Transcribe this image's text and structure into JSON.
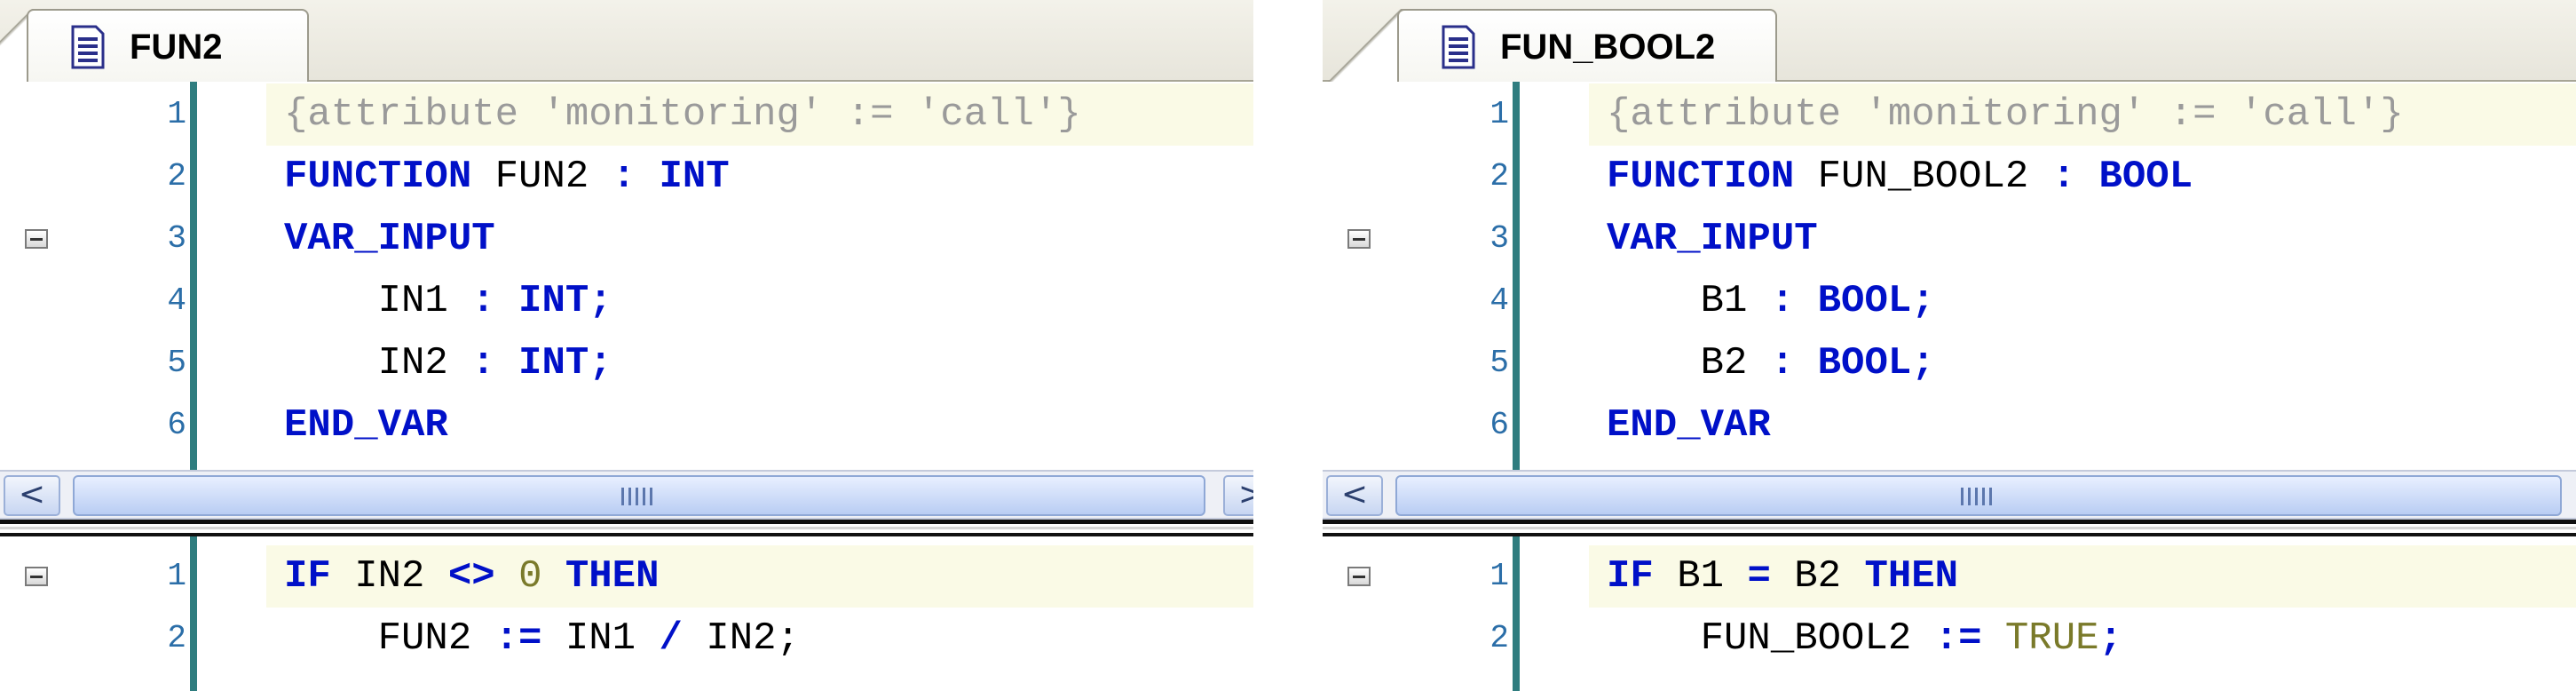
{
  "panels": [
    {
      "tab": {
        "title": "FUN2",
        "icon": "document-icon"
      },
      "declaration": {
        "lines": [
          {
            "n": "1",
            "tokens": [
              {
                "t": "{attribute 'monitoring' := 'call'}",
                "c": "cmt"
              }
            ],
            "highlight": true
          },
          {
            "n": "2",
            "tokens": [
              {
                "t": "FUNCTION",
                "c": "kw"
              },
              {
                "t": " FUN2 ",
                "c": ""
              },
              {
                "t": ":",
                "c": "kw"
              },
              {
                "t": " ",
                "c": ""
              },
              {
                "t": "INT",
                "c": "kw"
              }
            ]
          },
          {
            "n": "3",
            "fold": true,
            "tokens": [
              {
                "t": "VAR_INPUT",
                "c": "kw"
              }
            ]
          },
          {
            "n": "4",
            "tokens": [
              {
                "t": "    IN1 ",
                "c": ""
              },
              {
                "t": ":",
                "c": "kw"
              },
              {
                "t": " ",
                "c": ""
              },
              {
                "t": "INT;",
                "c": "kw"
              }
            ]
          },
          {
            "n": "5",
            "tokens": [
              {
                "t": "    IN2 ",
                "c": ""
              },
              {
                "t": ":",
                "c": "kw"
              },
              {
                "t": " ",
                "c": ""
              },
              {
                "t": "INT;",
                "c": "kw"
              }
            ]
          },
          {
            "n": "6",
            "tokens": [
              {
                "t": "END_VAR",
                "c": "kw"
              }
            ]
          }
        ]
      },
      "implementation": {
        "lines": [
          {
            "n": "1",
            "fold": true,
            "highlight": true,
            "tokens": [
              {
                "t": "IF",
                "c": "kw"
              },
              {
                "t": " IN2 ",
                "c": ""
              },
              {
                "t": "<>",
                "c": "kw"
              },
              {
                "t": " ",
                "c": ""
              },
              {
                "t": "0",
                "c": "lit"
              },
              {
                "t": " ",
                "c": ""
              },
              {
                "t": "THEN",
                "c": "kw"
              }
            ]
          },
          {
            "n": "2",
            "tokens": [
              {
                "t": "    FUN2 ",
                "c": ""
              },
              {
                "t": ":=",
                "c": "kw"
              },
              {
                "t": " IN1 ",
                "c": ""
              },
              {
                "t": "/",
                "c": "kw"
              },
              {
                "t": " IN2;",
                "c": ""
              }
            ]
          }
        ]
      },
      "scrollbar": {
        "left": "<",
        "right": ">"
      }
    },
    {
      "tab": {
        "title": "FUN_BOOL2",
        "icon": "document-icon"
      },
      "declaration": {
        "lines": [
          {
            "n": "1",
            "tokens": [
              {
                "t": "{attribute 'monitoring' := 'call'}",
                "c": "cmt"
              }
            ],
            "highlight": true
          },
          {
            "n": "2",
            "tokens": [
              {
                "t": "FUNCTION",
                "c": "kw"
              },
              {
                "t": " FUN_BOOL2 ",
                "c": ""
              },
              {
                "t": ":",
                "c": "kw"
              },
              {
                "t": " ",
                "c": ""
              },
              {
                "t": "BOOL",
                "c": "kw"
              }
            ]
          },
          {
            "n": "3",
            "fold": true,
            "tokens": [
              {
                "t": "VAR_INPUT",
                "c": "kw"
              }
            ]
          },
          {
            "n": "4",
            "tokens": [
              {
                "t": "    B1 ",
                "c": ""
              },
              {
                "t": ":",
                "c": "kw"
              },
              {
                "t": " ",
                "c": ""
              },
              {
                "t": "BOOL;",
                "c": "kw"
              }
            ]
          },
          {
            "n": "5",
            "tokens": [
              {
                "t": "    B2 ",
                "c": ""
              },
              {
                "t": ":",
                "c": "kw"
              },
              {
                "t": " ",
                "c": ""
              },
              {
                "t": "BOOL;",
                "c": "kw"
              }
            ]
          },
          {
            "n": "6",
            "tokens": [
              {
                "t": "END_VAR",
                "c": "kw"
              }
            ]
          }
        ]
      },
      "implementation": {
        "lines": [
          {
            "n": "1",
            "fold": true,
            "highlight": true,
            "tokens": [
              {
                "t": "IF",
                "c": "kw"
              },
              {
                "t": " B1 ",
                "c": ""
              },
              {
                "t": "=",
                "c": "kw"
              },
              {
                "t": " B2 ",
                "c": ""
              },
              {
                "t": "THEN",
                "c": "kw"
              }
            ]
          },
          {
            "n": "2",
            "tokens": [
              {
                "t": "    FUN_BOOL2 ",
                "c": ""
              },
              {
                "t": ":=",
                "c": "kw"
              },
              {
                "t": " ",
                "c": ""
              },
              {
                "t": "TRUE",
                "c": "lit"
              },
              {
                "t": ";",
                "c": "kw"
              }
            ]
          }
        ]
      },
      "scrollbar": {
        "left": "<",
        "right": ""
      }
    }
  ],
  "colors": {
    "keyword": "#0010c8",
    "comment": "#9a9a9a",
    "literal": "#7a7a2a",
    "line_number": "#2b6ea8",
    "gutter_bar": "#2f7d7f",
    "highlight": "#fafae6"
  }
}
